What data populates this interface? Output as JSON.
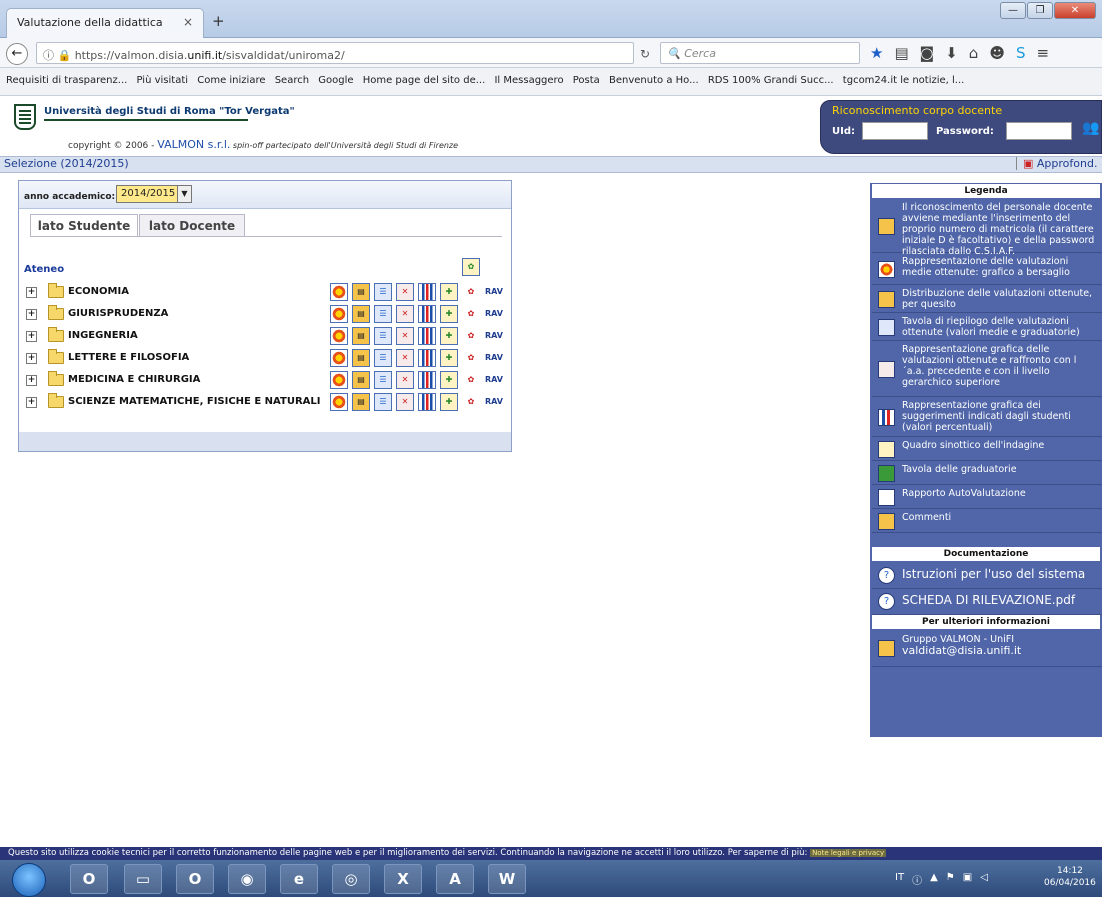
{
  "browser": {
    "tab_title": "Valutazione della didattica",
    "tab_close": "×",
    "new_tab": "+",
    "url_prefix": "https://valmon.disia.",
    "url_domain": "unifi.it",
    "url_path": "/sisvaldidat/uniroma2/",
    "search_placeholder": "Cerca",
    "bookmarks": [
      "Requisiti di trasparenz...",
      "Più visitati",
      "Come iniziare",
      "Search",
      "Google",
      "Home page del sito de...",
      "Il Messaggero",
      "Posta",
      "Benvenuto a Ho...",
      "RDS 100% Grandi Succ...",
      "tgcom24.it le notizie, l..."
    ]
  },
  "header": {
    "university": "Università degli Studi di Roma \"Tor Vergata\"",
    "copyright_prefix": "copyright © 2006 - ",
    "valmon": "VALMON s.r.l.",
    "spinoff": " spin-off partecipato dell'Università degli Studi di Firenze"
  },
  "login": {
    "title": "Riconoscimento corpo docente",
    "uid_label": "UId:",
    "password_label": "Password:"
  },
  "selection": {
    "title": "Selezione (2014/2015)",
    "approfond": "Approfond."
  },
  "main": {
    "year_label": "anno accademico:",
    "year_value": "2014/2015",
    "tabs": [
      "lato Studente",
      "lato Docente"
    ],
    "ateneo": "Ateneo",
    "faculties": [
      "ECONOMIA",
      "GIURISPRUDENZA",
      "INGEGNERIA",
      "LETTERE E FILOSOFIA",
      "MEDICINA E CHIRURGIA",
      "SCIENZE MATEMATICHE, FISICHE E NATURALI"
    ],
    "rav_label": "RAV"
  },
  "legend": {
    "title": "Legenda",
    "items": [
      "Il riconoscimento del personale docente avviene mediante l'inserimento del proprio numero di matricola (il carattere iniziale D è facoltativo) e della password rilasciata dallo C.S.I.A.F.",
      "Rappresentazione delle valutazioni medie ottenute: grafico a bersaglio",
      "Distribuzione delle valutazioni ottenute, per quesito",
      "Tavola di riepilogo delle valutazioni ottenute (valori medie e graduatorie)",
      "Rappresentazione grafica delle valutazioni ottenute e raffronto con l´a.a. precedente e con il livello gerarchico superiore",
      "Rappresentazione grafica dei suggerimenti indicati dagli studenti (valori percentuali)",
      "Quadro sinottico dell'indagine",
      "Tavola delle graduatorie",
      "Rapporto AutoValutazione",
      "Commenti"
    ],
    "doc_title": "Documentazione",
    "doc_items": [
      "Istruzioni per l'uso del sistema",
      "SCHEDA DI RILEVAZIONE.pdf"
    ],
    "info_title": "Per ulteriori informazioni",
    "info_line1": "Gruppo VALMON - UniFI",
    "info_line2": "valdidat@disia.unifi.it"
  },
  "cookie": {
    "text": "Questo sito utilizza cookie tecnici per il corretto funzionamento delle pagine web e per il miglioramento dei servizi. Continuando la navigazione ne accetti il loro utilizzo. Per saperne di più: ",
    "link": "Note legali e privacy"
  },
  "taskbar": {
    "lang": "IT",
    "time": "14:12",
    "date": "06/04/2016"
  }
}
